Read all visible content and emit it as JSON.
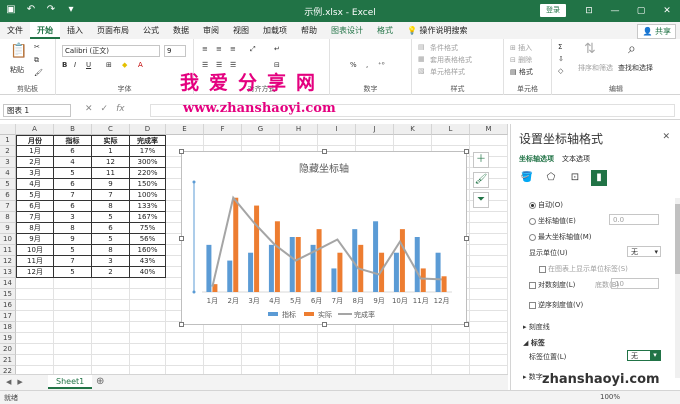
{
  "window": {
    "title": "示例.xlsx  -  Excel",
    "login": "登录",
    "minimize": "—",
    "restore": "▢",
    "close": "✕"
  },
  "tabs": [
    "文件",
    "开始",
    "插入",
    "页面布局",
    "公式",
    "数据",
    "审阅",
    "视图",
    "加载项",
    "帮助",
    "图表设计",
    "格式"
  ],
  "tell_me": "操作说明搜索",
  "share": "共享",
  "ribbon": {
    "clipboard": {
      "paste": "粘贴",
      "label": "剪贴板"
    },
    "font": {
      "name": "Calibri (正文)",
      "size": "9",
      "label": "字体"
    },
    "alignment": {
      "label": "对齐方式"
    },
    "number": {
      "format": "%",
      "label": "数字"
    },
    "styles": {
      "conditional": "条件格式",
      "table": "套用表格格式",
      "cell": "单元格样式",
      "label": "样式"
    },
    "cells": {
      "insert": "插入",
      "delete": "删除",
      "format": "格式",
      "label": "单元格"
    },
    "editing": {
      "sort": "排序和筛选",
      "find": "查找和选择",
      "label": "编辑"
    }
  },
  "watermark": {
    "cn": "我爱分享网",
    "url": "www.zhanshaoyi.com",
    "url2": "zhanshaoyi.com"
  },
  "formula_bar": {
    "namebox": "图表 1",
    "cancel": "✕",
    "enter": "✓",
    "fx": "fx"
  },
  "columns": [
    "A",
    "B",
    "C",
    "D",
    "E",
    "F",
    "G",
    "H",
    "I",
    "J",
    "K",
    "L",
    "M"
  ],
  "rows": [
    "1",
    "2",
    "3",
    "4",
    "5",
    "6",
    "7",
    "8",
    "9",
    "10",
    "11",
    "12",
    "13",
    "14",
    "15",
    "16",
    "17",
    "18",
    "19",
    "20",
    "21",
    "22"
  ],
  "table": {
    "headers": [
      "月份",
      "指标",
      "实际",
      "完成率"
    ],
    "rows": [
      [
        "1月",
        "6",
        "1",
        "17%"
      ],
      [
        "2月",
        "4",
        "12",
        "300%"
      ],
      [
        "3月",
        "5",
        "11",
        "220%"
      ],
      [
        "4月",
        "6",
        "9",
        "150%"
      ],
      [
        "5月",
        "7",
        "7",
        "100%"
      ],
      [
        "6月",
        "6",
        "8",
        "133%"
      ],
      [
        "7月",
        "3",
        "5",
        "167%"
      ],
      [
        "8月",
        "8",
        "6",
        "75%"
      ],
      [
        "9月",
        "9",
        "5",
        "56%"
      ],
      [
        "10月",
        "5",
        "8",
        "160%"
      ],
      [
        "11月",
        "7",
        "3",
        "43%"
      ],
      [
        "12月",
        "5",
        "2",
        "40%"
      ]
    ]
  },
  "chart_data": {
    "type": "bar",
    "title": "隐藏坐标轴",
    "categories": [
      "1月",
      "2月",
      "3月",
      "4月",
      "5月",
      "6月",
      "7月",
      "8月",
      "9月",
      "10月",
      "11月",
      "12月"
    ],
    "series": [
      {
        "name": "指标",
        "kind": "bar",
        "values": [
          6,
          4,
          5,
          6,
          7,
          6,
          3,
          8,
          9,
          5,
          7,
          5
        ],
        "color": "#5b9bd5"
      },
      {
        "name": "实际",
        "kind": "bar",
        "values": [
          1,
          12,
          11,
          9,
          7,
          8,
          5,
          6,
          5,
          8,
          3,
          2
        ],
        "color": "#ed7d31"
      },
      {
        "name": "完成率",
        "kind": "line",
        "axis": "secondary",
        "values": [
          0.17,
          3.0,
          2.2,
          1.5,
          1.0,
          1.33,
          1.67,
          0.75,
          0.56,
          1.6,
          0.43,
          0.4
        ],
        "color": "#a5a5a5"
      }
    ],
    "ylim": [
      0,
      14
    ],
    "y2lim": [
      0,
      3.5
    ],
    "legend": "bottom",
    "grid": false
  },
  "sheet_tab": "Sheet1",
  "add_sheet": "⊕",
  "status": {
    "ready": "就绪",
    "zoom": "100%"
  },
  "pane": {
    "title": "设置坐标轴格式",
    "close": "✕",
    "tab_axis": "坐标轴选项",
    "tab_text": "文本选项",
    "auto": "自动(O)",
    "axis_value": "坐标轴值(E)",
    "axis_value_num": "0.0",
    "max_value": "最大坐标轴值(M)",
    "display_units": "显示单位(U)",
    "display_units_val": "无",
    "show_units_label": "在图表上显示单位标签(S)",
    "log_scale": "对数刻度(L)",
    "base": "底数(B)",
    "base_val": "10",
    "reverse": "逆序刻度值(V)",
    "tick_marks": "刻度线",
    "labels": "标签",
    "label_position": "标签位置(L)",
    "label_position_val": "无",
    "number": "数字"
  },
  "colors": {
    "excel_green": "#217346",
    "watermark": "#e4007f"
  }
}
